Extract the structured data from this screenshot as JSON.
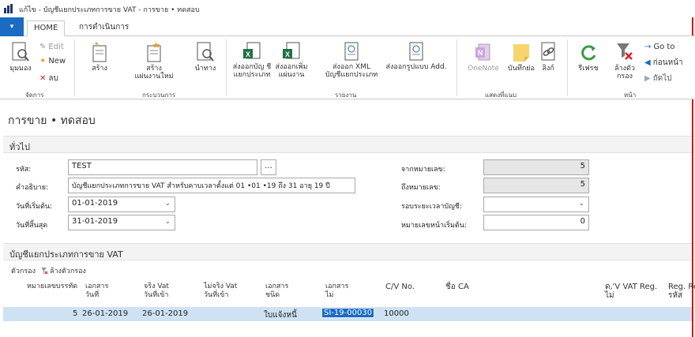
{
  "window": {
    "title": "แก้ไข - บัญชีแยกประเภทการขาย VAT -    การขาย • ทดสอบ"
  },
  "ribbon": {
    "file_label": "▾",
    "tabs": [
      "HOME",
      "การดำเนินการ"
    ],
    "manage": {
      "view": "มุมมอง",
      "edit": "Edit",
      "new": "New",
      "delete": "ลบ",
      "group": "จัดการ"
    },
    "process": {
      "create": "สร้าง",
      "create_new_page": "สร้าง",
      "create_new_sub": "แผ่นงานใหม่",
      "import": "นำทาง",
      "group": "กระบวนการ"
    },
    "report": {
      "export_excel": "ส่งออกบัญ ชีแยกประเภท",
      "export_excel2": "ส่งออกเพิ่ม แผ่นงาน",
      "export_xml": "ส่งออก XML",
      "ledger_vat": "บัญชีแยกประเภท",
      "export_add": "ส่งออกรูปแบบ Add.",
      "group": "รายงาน"
    },
    "show_attached": {
      "onenote": "OneNote",
      "notes": "บันทึกย่อ",
      "links": "ลิงก์",
      "group": "แสดงที่แนบ"
    },
    "page": {
      "refresh": "รีเฟรช",
      "clear_filter": "ล้างตัวกรอง",
      "goto": "Go to",
      "previous": "ก่อนหน้า",
      "next": "ถัดไป",
      "group": "หน้า"
    }
  },
  "page_title": "การขาย • ทดสอบ",
  "general": {
    "header": "ทั่วไป",
    "code_label": "รหัส:",
    "code_value": "TEST",
    "desc_label": "คำอธิบาย:",
    "desc_value": "บัญชีแยกประเภทการขาย VAT สำหรับคาบเวลาตั้งแต่ 01 •01 •19 ถึง 31 อายุ 19 ปี",
    "start_label": "วันที่เริ่มต้น:",
    "start_value": "01-01-2019",
    "end_label": "วันที่สิ้นสุด",
    "end_value": "31-01-2019",
    "from_no_label": "จากหมายเลข:",
    "from_no_value": "5",
    "to_no_label": "ถึงหมายเลข:",
    "to_no_value": "5",
    "period_label": "รอบระยะเวลาบัญชี:",
    "period_value": "",
    "start_page_label": "หมายเลขหน้าเริ่มต้น:",
    "start_page_value": "0"
  },
  "lines": {
    "header": "บัญชีแยกประเภทการขาย VAT",
    "tool_filter": "ตัวกรอง",
    "tool_clear": "ล้างตัวกรอง",
    "columns": [
      {
        "l1": "หมายเลขบรรทัด",
        "l2": ""
      },
      {
        "l1": "เอกสาร",
        "l2": "วันที่"
      },
      {
        "l1": "จริง Vat",
        "l2": "วันที่เข้า"
      },
      {
        "l1": "ไม่จริง Vat",
        "l2": "วันที่เข้า"
      },
      {
        "l1": "เอกสาร",
        "l2": "ชนิด"
      },
      {
        "l1": "เอกสาร",
        "l2": "ไม่"
      },
      {
        "l1": "C/V No.",
        "l2": ""
      },
      {
        "l1": "ชื่อ CA",
        "l2": ""
      },
      {
        "l1": "ด,'V VAT Reg.",
        "l2": "ไม่"
      },
      {
        "l1": "Reg. Re",
        "l2": "รหัส"
      }
    ],
    "row": {
      "line_no": "5",
      "doc_date": "26-01-2019",
      "vat_date": "26-01-2019",
      "unreal_date": "",
      "doc_type": "ใบแจ้งหนี้",
      "doc_no": "SI-19-00030",
      "cv_no": "10000",
      "name": "",
      "vat_reg": "",
      "reg": ""
    }
  }
}
